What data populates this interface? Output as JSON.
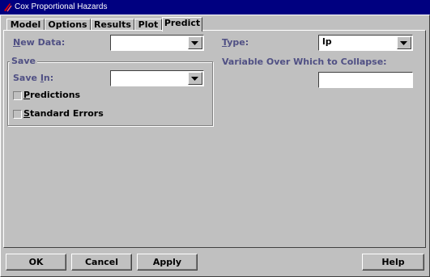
{
  "window": {
    "title": "Cox Proportional Hazards"
  },
  "tabs": [
    {
      "label": "Model"
    },
    {
      "label": "Options"
    },
    {
      "label": "Results"
    },
    {
      "label": "Plot"
    },
    {
      "label": "Predict"
    }
  ],
  "predict": {
    "new_data_label_accel": "N",
    "new_data_label_rest": "ew Data:",
    "new_data_value": "",
    "type_label_accel": "T",
    "type_label_rest": "ype:",
    "type_value": "lp",
    "save_group_title": "Save",
    "save_in_label_accel": "Save ",
    "save_in_label_u": "I",
    "save_in_label_rest": "n:",
    "save_in_value": "",
    "predictions_accel": "P",
    "predictions_rest": "redictions",
    "predictions_checked": false,
    "std_errors_accel": "S",
    "std_errors_rest": "tandard Errors",
    "std_errors_checked": false,
    "collapse_label": "Variable Over Which to Collapse:",
    "collapse_value": ""
  },
  "buttons": {
    "ok": "OK",
    "cancel": "Cancel",
    "apply": "Apply",
    "help": "Help"
  }
}
